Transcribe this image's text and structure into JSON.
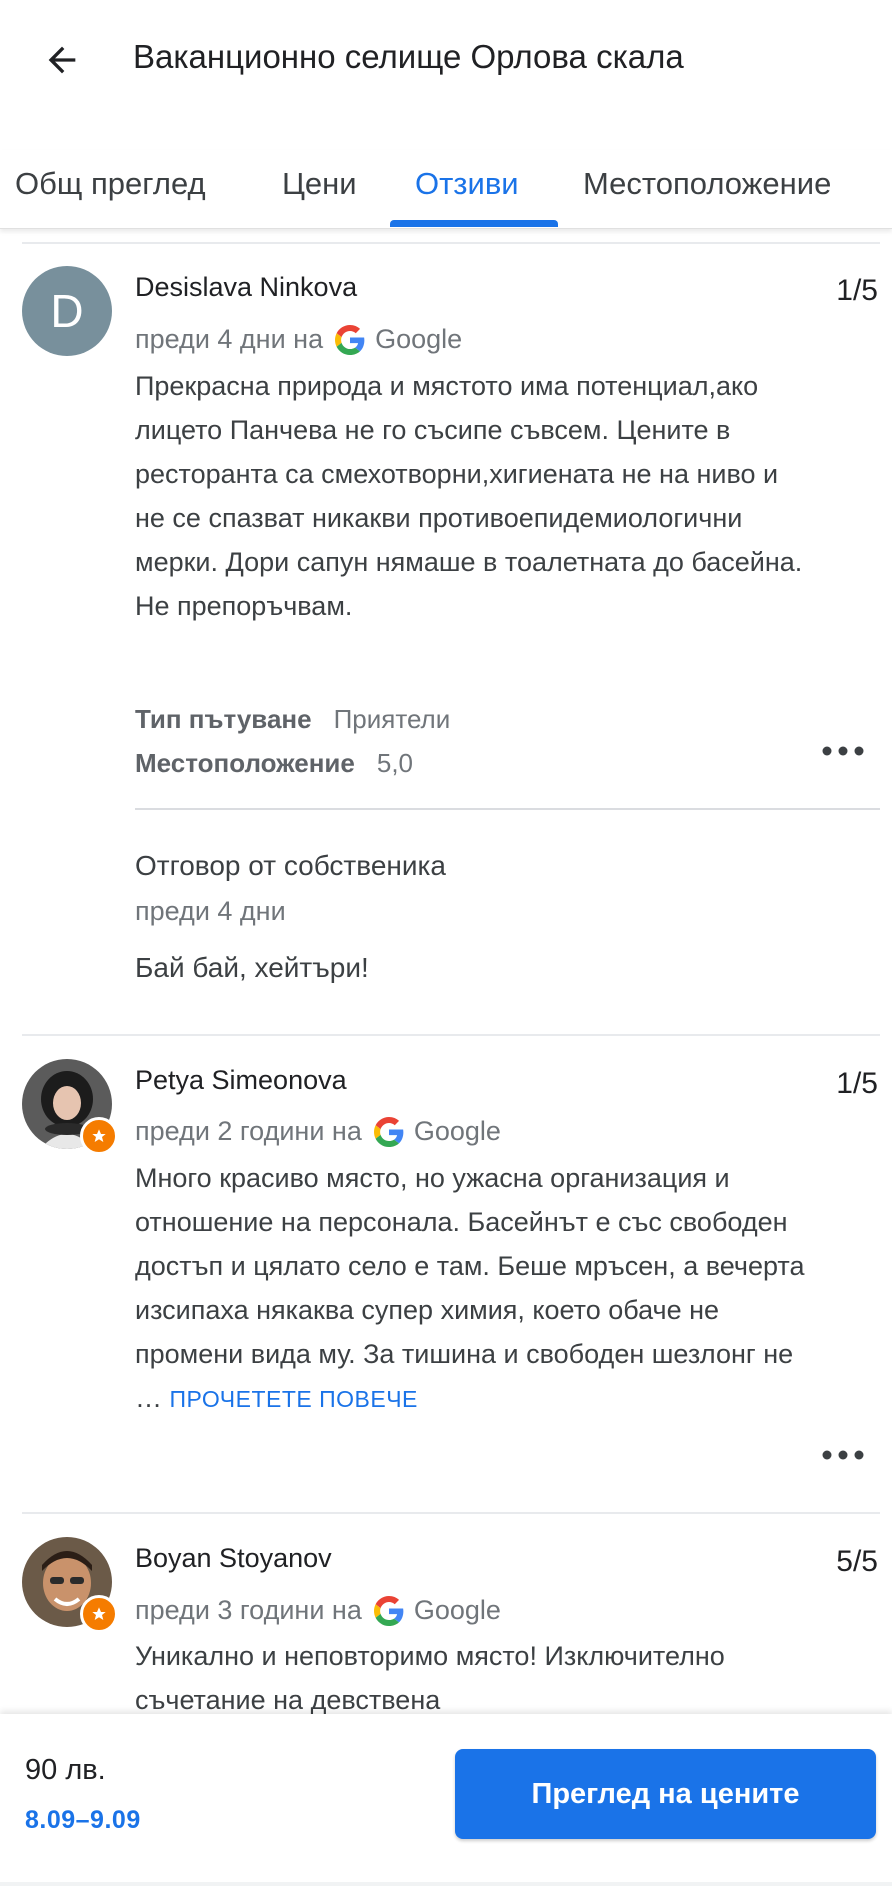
{
  "header": {
    "title": "Ваканционно селище Орлова скала",
    "back_icon": "arrow-back-icon"
  },
  "tabs": [
    {
      "label": "Общ преглед",
      "active": false
    },
    {
      "label": "Цени",
      "active": false
    },
    {
      "label": "Отзиви",
      "active": true
    },
    {
      "label": "Местоположение",
      "active": false
    }
  ],
  "reviews": [
    {
      "reviewer": "Desislava Ninkova",
      "avatar_letter": "D",
      "rating": "1/5",
      "time": "преди 4 дни на",
      "source": "Google",
      "text": "Прекрасна природа и мястото има потенциал,ако лицето Панчева не го съсипе съвсем. Цените в ресторанта са смехотворни,хигиената не на ниво и не се спазват никакви противоепидемиологични мерки. Дори сапун нямаше в тоалетната до басейна. Не препоръчвам.",
      "details": [
        {
          "key": "Тип пътуване",
          "value": "Приятели"
        },
        {
          "key": "Местоположение",
          "value": "5,0"
        }
      ],
      "owner_reply": {
        "title": "Отговор от собственика",
        "time": "преди 4 дни",
        "text": "Бай бай, хейтъри!"
      }
    },
    {
      "reviewer": "Petya Simeonova",
      "rating": "1/5",
      "time": "преди 2 години на",
      "source": "Google",
      "text": "Много красиво място, но ужасна организация и отношение на персонала. Басейнът е със свободен достъп и цялато село е там. Беше мръсен, а вечерта изсипаха някаква супер химия, което обаче не промени вида му. За тишина и свободен шезлонг не …",
      "read_more": "ПРОЧЕТЕТЕ ПОВЕЧЕ"
    },
    {
      "reviewer": "Boyan Stoyanov",
      "rating": "5/5",
      "time": "преди 3 години на",
      "source": "Google",
      "text": "Уникално и неповторимо място! Изключително съчетание на девствена"
    }
  ],
  "bottom_bar": {
    "price": "90 лв.",
    "dates": "8.09–9.09",
    "cta_label": "Преглед на цените"
  },
  "colors": {
    "accent": "#1a73e8",
    "avatar_letter_bg": "#78909c",
    "local_guide_badge": "#f57c00"
  }
}
